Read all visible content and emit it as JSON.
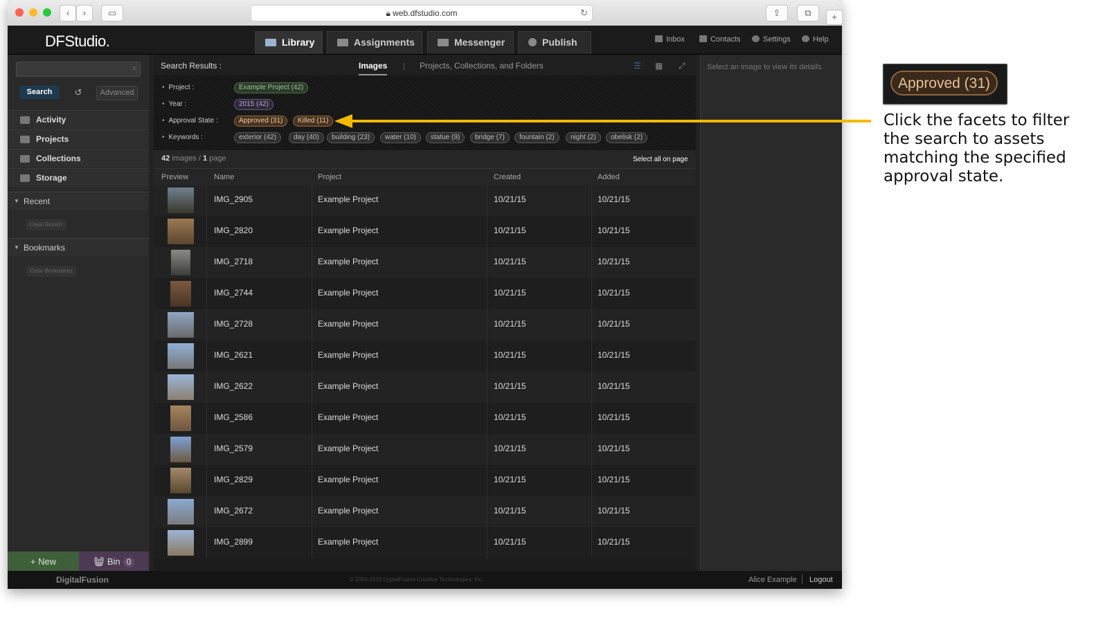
{
  "browser": {
    "url": "web.dfstudio.com"
  },
  "app": {
    "logo": "DFStudio.",
    "tabs": [
      {
        "label": "Library"
      },
      {
        "label": "Assignments"
      },
      {
        "label": "Messenger"
      },
      {
        "label": "Publish"
      }
    ],
    "top_links": [
      {
        "label": "Inbox"
      },
      {
        "label": "Contacts"
      },
      {
        "label": "Settings"
      },
      {
        "label": "Help"
      }
    ]
  },
  "sidebar": {
    "search_button": "Search",
    "advanced_button": "Advanced",
    "nav": [
      {
        "label": "Activity"
      },
      {
        "label": "Projects"
      },
      {
        "label": "Collections"
      },
      {
        "label": "Storage"
      }
    ],
    "recent_label": "Recent",
    "clear_recent": "Clear Recent",
    "bookmarks_label": "Bookmarks",
    "clear_bookmarks": "Clear Bookmarks",
    "new_button": "+ New",
    "bin_label": "Bin",
    "bin_count": "0"
  },
  "results": {
    "title": "Search Results :",
    "tab_images": "Images",
    "tab_other": "Projects, Collections, and Folders",
    "facets": {
      "project_label": "Project :",
      "year_label": "Year :",
      "approval_label": "Approval State :",
      "keywords_label": "Keywords :",
      "project": [
        "Example Project (42)"
      ],
      "year": [
        "2015 (42)"
      ],
      "approval": [
        "Approved (31)",
        "Killed (11)"
      ],
      "keywords": [
        "exterior (42)",
        "day (40)",
        "building (23)",
        "water (10)",
        "statue (9)",
        "bridge (7)",
        "fountain (2)",
        "night (2)",
        "obelisk (2)"
      ]
    },
    "count_images": "42",
    "count_images_label": "images",
    "count_sep": "/",
    "count_pages": "1",
    "count_pages_label": "page",
    "select_all": "Select all on page",
    "columns": [
      "Preview",
      "Name",
      "Project",
      "Created",
      "Added"
    ],
    "rows": [
      {
        "name": "IMG_2905",
        "project": "Example Project",
        "created": "10/21/15",
        "added": "10/21/15"
      },
      {
        "name": "IMG_2820",
        "project": "Example Project",
        "created": "10/21/15",
        "added": "10/21/15"
      },
      {
        "name": "IMG_2718",
        "project": "Example Project",
        "created": "10/21/15",
        "added": "10/21/15"
      },
      {
        "name": "IMG_2744",
        "project": "Example Project",
        "created": "10/21/15",
        "added": "10/21/15"
      },
      {
        "name": "IMG_2728",
        "project": "Example Project",
        "created": "10/21/15",
        "added": "10/21/15"
      },
      {
        "name": "IMG_2621",
        "project": "Example Project",
        "created": "10/21/15",
        "added": "10/21/15"
      },
      {
        "name": "IMG_2622",
        "project": "Example Project",
        "created": "10/21/15",
        "added": "10/21/15"
      },
      {
        "name": "IMG_2586",
        "project": "Example Project",
        "created": "10/21/15",
        "added": "10/21/15"
      },
      {
        "name": "IMG_2579",
        "project": "Example Project",
        "created": "10/21/15",
        "added": "10/21/15"
      },
      {
        "name": "IMG_2829",
        "project": "Example Project",
        "created": "10/21/15",
        "added": "10/21/15"
      },
      {
        "name": "IMG_2672",
        "project": "Example Project",
        "created": "10/21/15",
        "added": "10/21/15"
      },
      {
        "name": "IMG_2899",
        "project": "Example Project",
        "created": "10/21/15",
        "added": "10/21/15"
      }
    ]
  },
  "details": {
    "message": "Select an image to view its details."
  },
  "footer": {
    "brand": "DigitalFusion",
    "copyright": "© 2000-2018 DigitalFusion Creative Technologies, Inc.",
    "user": "Alice Example",
    "logout": "Logout"
  },
  "annotation": {
    "badge": "Approved (31)",
    "text": "Click the facets to filter the search to assets matching the specified approval state.",
    "arrow_color": "#f5b800"
  },
  "colors": {
    "approved_chip": "#4a3320",
    "project_chip": "#2b3a2a",
    "year_chip": "#2e2838",
    "new_button": "#3f5e3a",
    "bin_button": "#4b3a52"
  }
}
